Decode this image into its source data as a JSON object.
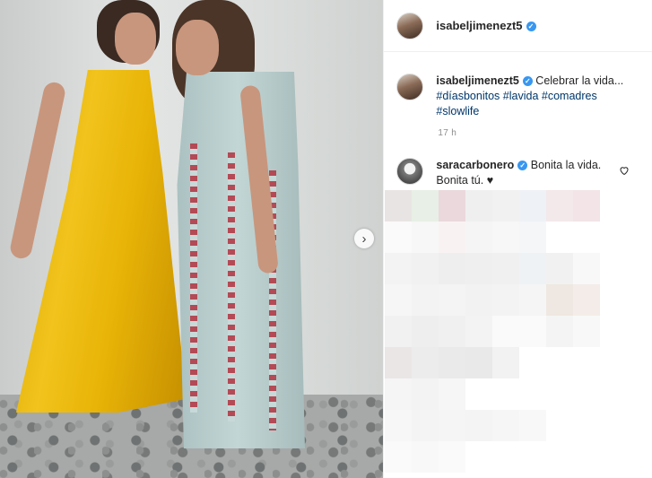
{
  "post": {
    "author": "isabeljimenezt5",
    "caption_text": "Celebrar la vida...",
    "hashtags": [
      "#díasbonitos",
      "#lavida",
      "#comadres",
      "#slowlife"
    ],
    "time_ago": "17 h"
  },
  "comments": [
    {
      "user": "saracarbonero",
      "text": "Bonita la vida. Bonita tú. ♥"
    }
  ],
  "icons": {
    "next": "chevron-right-icon",
    "verified": "verified-badge-icon",
    "like": "heart-icon"
  },
  "colors": {
    "verified": "#3897f0",
    "hashtag": "#00376b",
    "muted": "#8e8e8e"
  }
}
